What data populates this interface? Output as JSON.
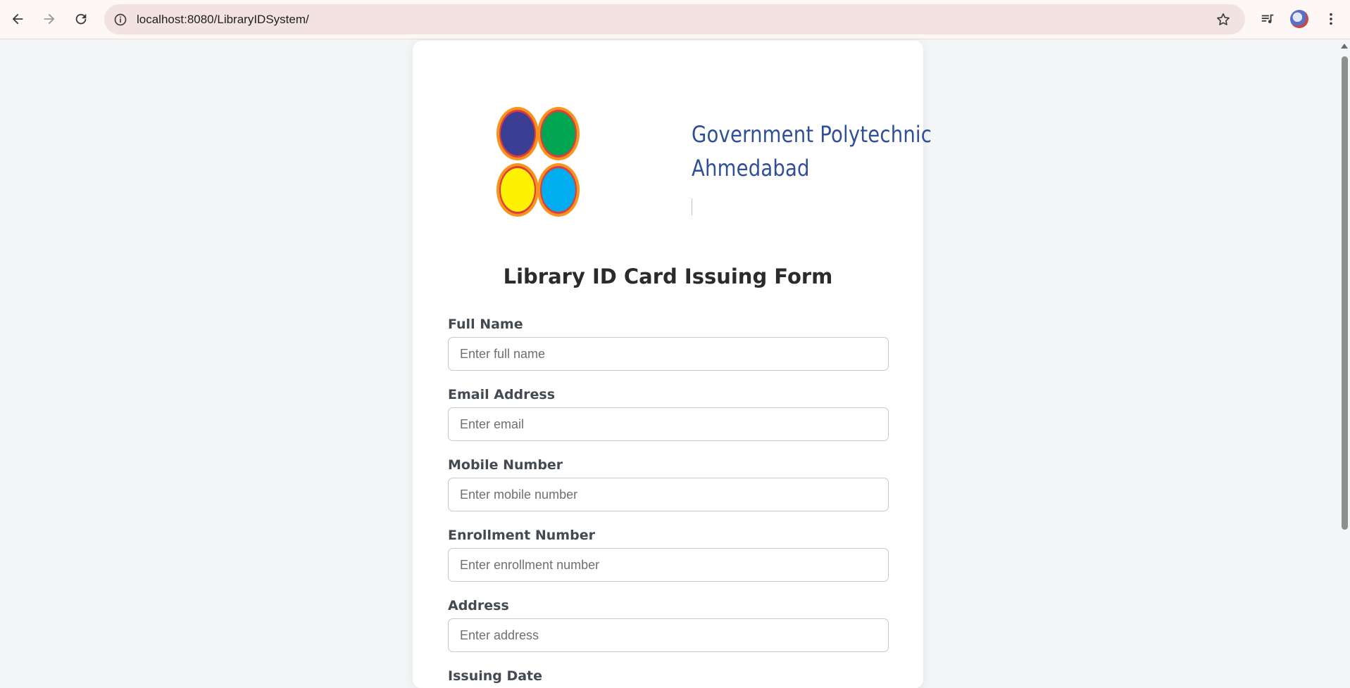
{
  "browser": {
    "url": "localhost:8080/LibraryIDSystem/"
  },
  "page": {
    "org_name_line1": "Government Polytechnic",
    "org_name_line2": "Ahmedabad",
    "form_title": "Library ID Card Issuing Form",
    "fields": [
      {
        "label": "Full Name",
        "placeholder": "Enter full name",
        "value": ""
      },
      {
        "label": "Email Address",
        "placeholder": "Enter email",
        "value": ""
      },
      {
        "label": "Mobile Number",
        "placeholder": "Enter mobile number",
        "value": ""
      },
      {
        "label": "Enrollment Number",
        "placeholder": "Enter enrollment number",
        "value": ""
      },
      {
        "label": "Address",
        "placeholder": "Enter address",
        "value": ""
      },
      {
        "label": "Issuing Date",
        "placeholder": "",
        "value": ""
      }
    ]
  },
  "colors": {
    "page_bg": "#f2f6f7",
    "org_text": "#2f4f9a",
    "logo_blue": "#3b3f94",
    "logo_green": "#00a651",
    "logo_yellow": "#fff200",
    "logo_cyan": "#00aeef",
    "logo_red": "#e03a3e",
    "logo_orange": "#f7941d"
  },
  "icons": [
    "back-arrow-icon",
    "forward-arrow-icon",
    "reload-icon",
    "site-info-icon",
    "bookmark-star-icon",
    "media-queue-icon",
    "profile-avatar",
    "kebab-menu-icon"
  ]
}
